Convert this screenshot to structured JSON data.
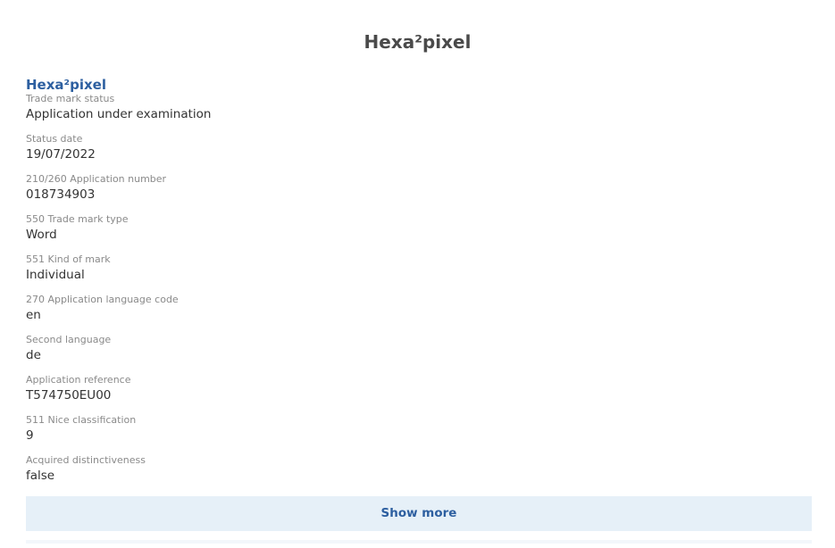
{
  "page": {
    "title": "Hexa²pixel"
  },
  "mark": {
    "name": "Hexa²pixel"
  },
  "fields": [
    {
      "label": "Trade mark status",
      "value": "Application under examination"
    },
    {
      "label": "Status date",
      "value": "19/07/2022"
    },
    {
      "label": "210/260 Application number",
      "value": "018734903"
    },
    {
      "label": "550 Trade mark type",
      "value": "Word"
    },
    {
      "label": "551 Kind of mark",
      "value": "Individual"
    },
    {
      "label": "270 Application language code",
      "value": "en"
    },
    {
      "label": "Second language",
      "value": "de"
    },
    {
      "label": "Application reference",
      "value": "T574750EU00"
    },
    {
      "label": "511 Nice classification",
      "value": "9"
    },
    {
      "label": "Acquired distinctiveness",
      "value": "false"
    }
  ],
  "actions": {
    "show_more_label": "Show more"
  },
  "colors": {
    "accent": "#2d5fa0",
    "button_bg": "#e6f0f8",
    "label": "#8a8a8a",
    "value": "#333333",
    "title": "#4a4a4a"
  }
}
